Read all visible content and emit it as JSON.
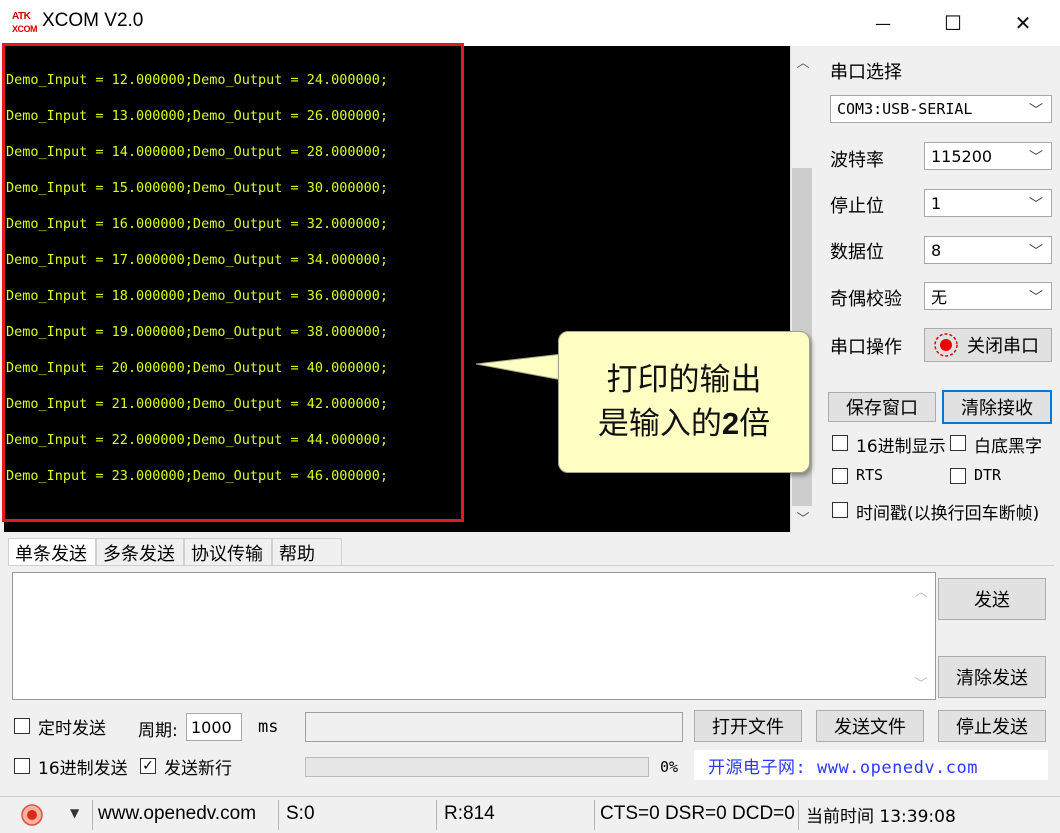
{
  "window": {
    "title": "XCOM V2.0",
    "logo_line1": "ATK",
    "logo_line2": "XCOM",
    "minimize": "—",
    "maximize": "☐",
    "close": "✕"
  },
  "receive": {
    "lines": [
      "Demo_Input = 12.000000;Demo_Output = 24.000000;",
      "Demo_Input = 13.000000;Demo_Output = 26.000000;",
      "Demo_Input = 14.000000;Demo_Output = 28.000000;",
      "Demo_Input = 15.000000;Demo_Output = 30.000000;",
      "Demo_Input = 16.000000;Demo_Output = 32.000000;",
      "Demo_Input = 17.000000;Demo_Output = 34.000000;",
      "Demo_Input = 18.000000;Demo_Output = 36.000000;",
      "Demo_Input = 19.000000;Demo_Output = 38.000000;",
      "Demo_Input = 20.000000;Demo_Output = 40.000000;",
      "Demo_Input = 21.000000;Demo_Output = 42.000000;",
      "Demo_Input = 22.000000;Demo_Output = 44.000000;",
      "Demo_Input = 23.000000;Demo_Output = 46.000000;"
    ],
    "text_color": "#d4ff1a",
    "highlight_color": "#e31b1b"
  },
  "callout": {
    "line1": "打印的输出",
    "line2_prefix": "是输入的",
    "line2_bold": "2",
    "line2_suffix": "倍"
  },
  "serial": {
    "port_label": "串口选择",
    "port_value": "COM3:USB-SERIAL",
    "baud_label": "波特率",
    "baud_value": "115200",
    "stop_label": "停止位",
    "stop_value": "1",
    "data_label": "数据位",
    "data_value": "8",
    "parity_label": "奇偶校验",
    "parity_value": "无",
    "op_label": "串口操作",
    "op_button": "关闭串口",
    "save_window": "保存窗口",
    "clear_receive": "清除接收",
    "hex_display": "16进制显示",
    "white_black": "白底黑字",
    "rts": "RTS",
    "dtr": "DTR",
    "timestamp": "时间戳(以换行回车断帧)"
  },
  "tabs": [
    "单条发送",
    "多条发送",
    "协议传输",
    "帮助"
  ],
  "send": {
    "send_button": "发送",
    "clear_send": "清除发送",
    "timed_send": "定时发送",
    "period_label": "周期:",
    "period_value": "1000",
    "period_unit": "ms",
    "open_file": "打开文件",
    "send_file": "发送文件",
    "stop_send": "停止发送",
    "hex_send": "16进制发送",
    "newline": "发送新行",
    "newline_checked": "✓",
    "progress_percent": "0%",
    "progress": 0,
    "promo": "开源电子网: www.openedv.com"
  },
  "status": {
    "website": "www.openedv.com",
    "sent": "S:0",
    "received": "R:814",
    "lines": "CTS=0 DSR=0 DCD=0",
    "time": "当前时间 13:39:08"
  }
}
